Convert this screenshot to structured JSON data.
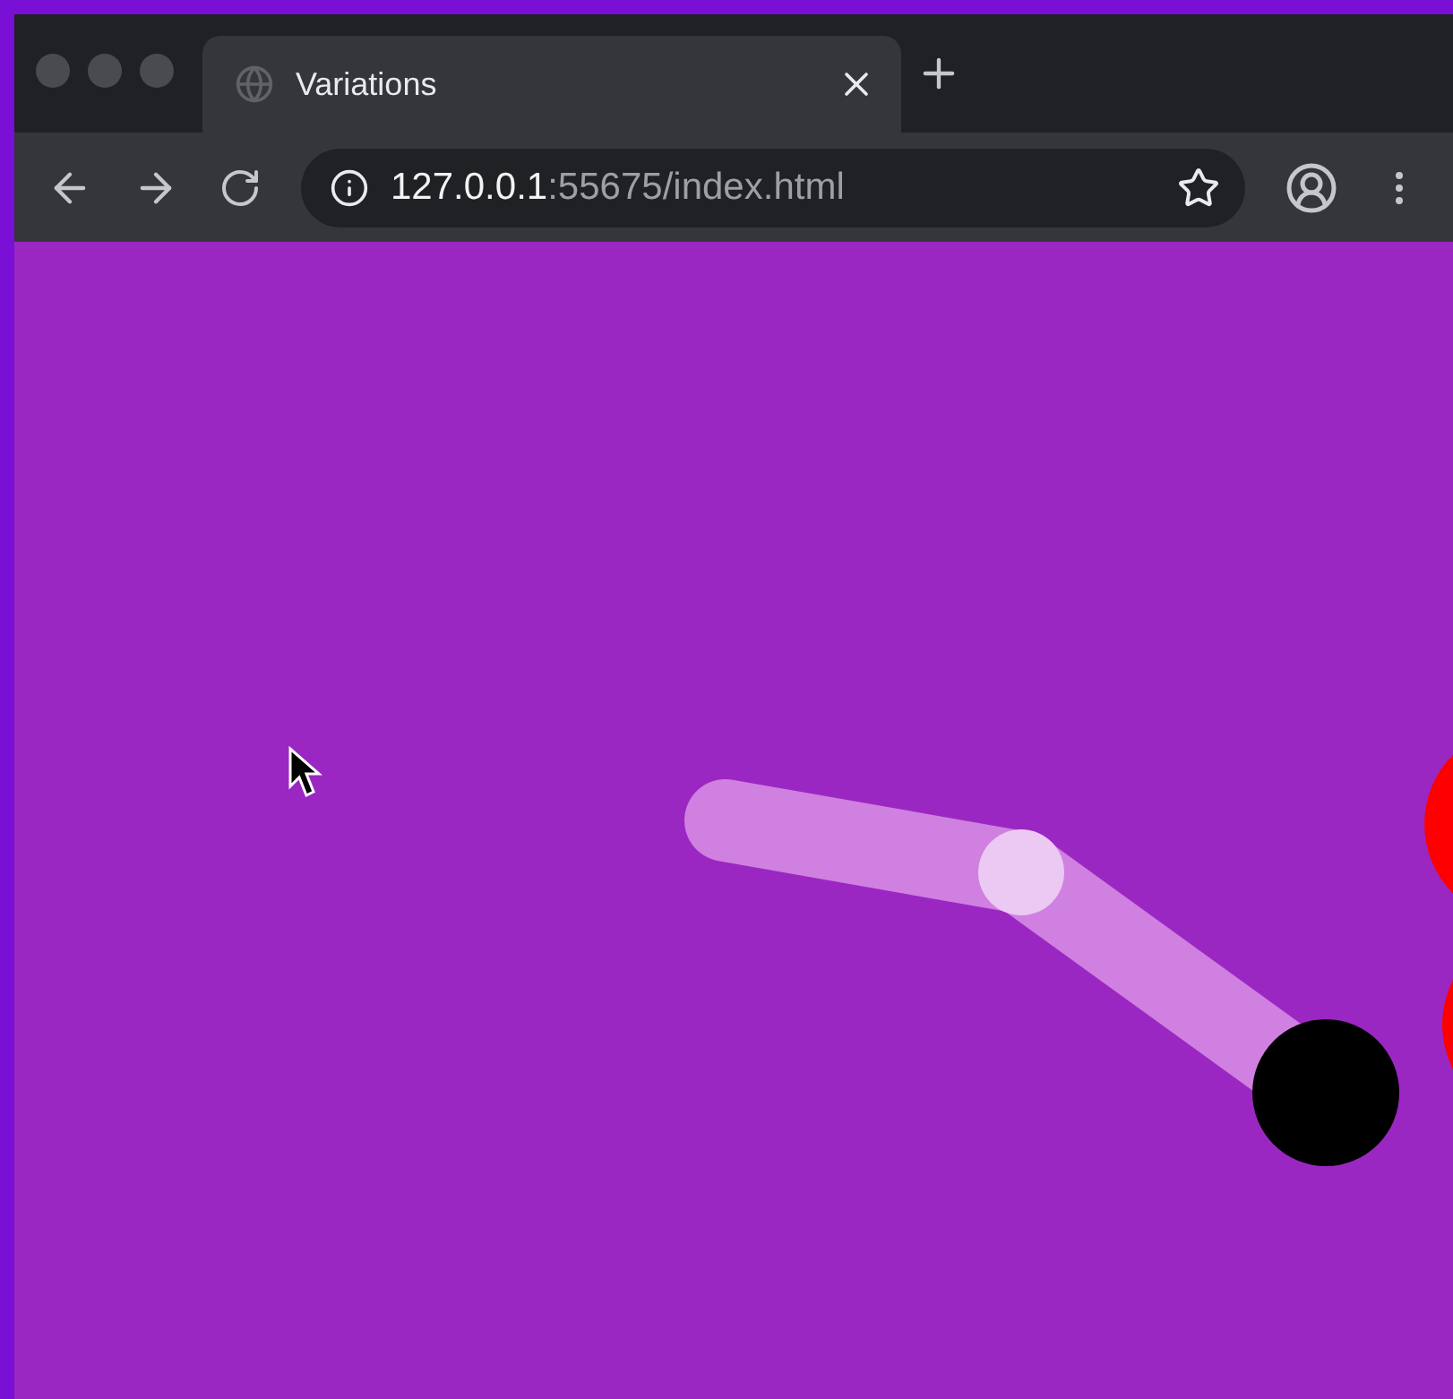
{
  "tabs": [
    {
      "title": "Variations",
      "selected": true
    }
  ],
  "address_bar": {
    "host": "127.0.0.1",
    "path": ":55675/index.html"
  }
}
